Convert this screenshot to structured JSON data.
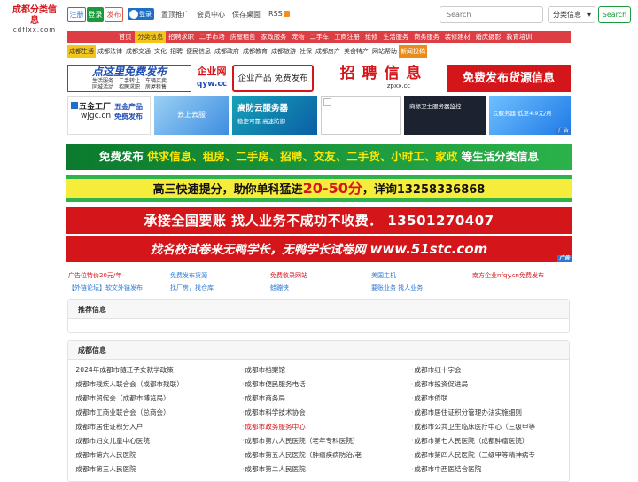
{
  "header": {
    "logo_line1": "成都分类信息",
    "logo_line2": "cdflxx.com",
    "register": "注册",
    "login": "登录",
    "post": "发布",
    "qq_login": "登录",
    "links": [
      "置顶推广",
      "会员中心",
      "保存桌面",
      "RSS"
    ],
    "search_placeholder": "Search",
    "category_select": "分类信息",
    "search_button": "Search"
  },
  "nav": {
    "items": [
      "首页",
      "分类信息",
      "招聘求职",
      "二手市场",
      "房屋租售",
      "家政服务",
      "宠物",
      "二手车",
      "工商注册",
      "维修",
      "生活服务",
      "商务服务",
      "装修建材",
      "婚庆摄影",
      "教育培训"
    ],
    "active": "分类信息"
  },
  "subnav": {
    "items": [
      "成都生活",
      "成都法律",
      "成都交通",
      "文化",
      "招聘",
      "便民信息",
      "成都政府",
      "成都教育",
      "成都旅游",
      "社保",
      "成都房产",
      "美食特产",
      "网站帮助",
      "新闻投稿"
    ],
    "active": "成都生活",
    "highlight": "新闻投稿"
  },
  "ads": {
    "ad1_title": "点这里免费发布",
    "ad1_lines": [
      "生活服务　二手转让　车辆买卖",
      "同城活动　招聘求职　房屋租售"
    ],
    "ad2_title": "企业网",
    "ad2_sub": "qyw.cc",
    "ad3": "企业产品 免费发布",
    "ad4_title": "招 聘 信 息",
    "ad4_sub": "zpxx.cc",
    "ad5": "免费发布货源信息",
    "ad6_title": "五金工厂",
    "ad6_sub": "wjgc.cn",
    "ad7": "五金产品 免费发布",
    "ad8": "云上云服",
    "ad9_title": "高防云服务器",
    "ad9_sub": "稳定可靠 高速防御",
    "ad11": "商标卫士服务器监控",
    "ad12": "云服务器 低至4.9元/月",
    "ad_tag": "广告",
    "banner1_a": "免费发布",
    "banner1_b": "供求信息、租房、二手房、招聘、交友、二手货、小时工、家政",
    "banner1_c": "等生活分类信息",
    "banner2_a": "高三快速提分，助你单科猛进",
    "banner2_b": "20-50分",
    "banner2_c": "，详询13258336868",
    "banner3": "承接全国要账 找人业务不成功不收费． 13501270407",
    "banner4_a": "找名校试卷来无鸭学长，无鸭学长试卷网",
    "banner4_b": "www.51stc.com"
  },
  "text_links": [
    {
      "text": "广告位特价20元/年",
      "color": "#d4161b"
    },
    {
      "text": "免费发布货源",
      "color": "#2c78d4"
    },
    {
      "text": "免费收录网站",
      "color": "#d4161b"
    },
    {
      "text": "美国主机",
      "color": "#2c78d4"
    },
    {
      "text": "南方企业nfqy.cn免费发布",
      "color": "#d4161b"
    },
    {
      "text": "【外链论坛】软文外链发布",
      "color": "#2c78d4"
    },
    {
      "text": "找厂房，找仓库",
      "color": "#2c78d4"
    },
    {
      "text": "蛙蹦侠",
      "color": "#2c78d4"
    },
    {
      "text": "要账业务 找人业务",
      "color": "#2c78d4"
    }
  ],
  "recommend": {
    "title": "推荐信息"
  },
  "info": {
    "title": "成都信息",
    "items": [
      {
        "text": "2024年成都市随迁子女就学政策",
        "red": false
      },
      {
        "text": "成都市档案馆",
        "red": false
      },
      {
        "text": "成都市红十字会",
        "red": false
      },
      {
        "text": "成都市残疾人联合会（成都市残联）",
        "red": false
      },
      {
        "text": "成都市便民服务电话",
        "red": false
      },
      {
        "text": "成都市投资促进局",
        "red": false
      },
      {
        "text": "成都市贸促会（成都市博览局）",
        "red": false
      },
      {
        "text": "成都市商务局",
        "red": false
      },
      {
        "text": "成都市侨联",
        "red": false
      },
      {
        "text": "成都市工商业联合会（总商会）",
        "red": false
      },
      {
        "text": "成都市科学技术协会",
        "red": false
      },
      {
        "text": "成都市居住证积分管理办法实施细则",
        "red": false
      },
      {
        "text": "成都市居住证积分入户",
        "red": false
      },
      {
        "text": "成都市政务服务中心",
        "red": true
      },
      {
        "text": "成都市公共卫生临床医疗中心（三级甲等",
        "red": false
      },
      {
        "text": "成都市妇女儿童中心医院",
        "red": false
      },
      {
        "text": "成都市第八人民医院（老年专科医院）",
        "red": false
      },
      {
        "text": "成都市第七人民医院（成都肿瘤医院）",
        "red": false
      },
      {
        "text": "成都市第六人民医院",
        "red": false
      },
      {
        "text": "成都市第五人民医院（肿瘤疾病防治/老",
        "red": false
      },
      {
        "text": "成都市第四人民医院（三级甲等精神病专",
        "red": false
      },
      {
        "text": "成都市第三人民医院",
        "red": false
      },
      {
        "text": "成都市第二人民医院",
        "red": false
      },
      {
        "text": "成都市中西医结合医院",
        "red": false
      }
    ]
  }
}
